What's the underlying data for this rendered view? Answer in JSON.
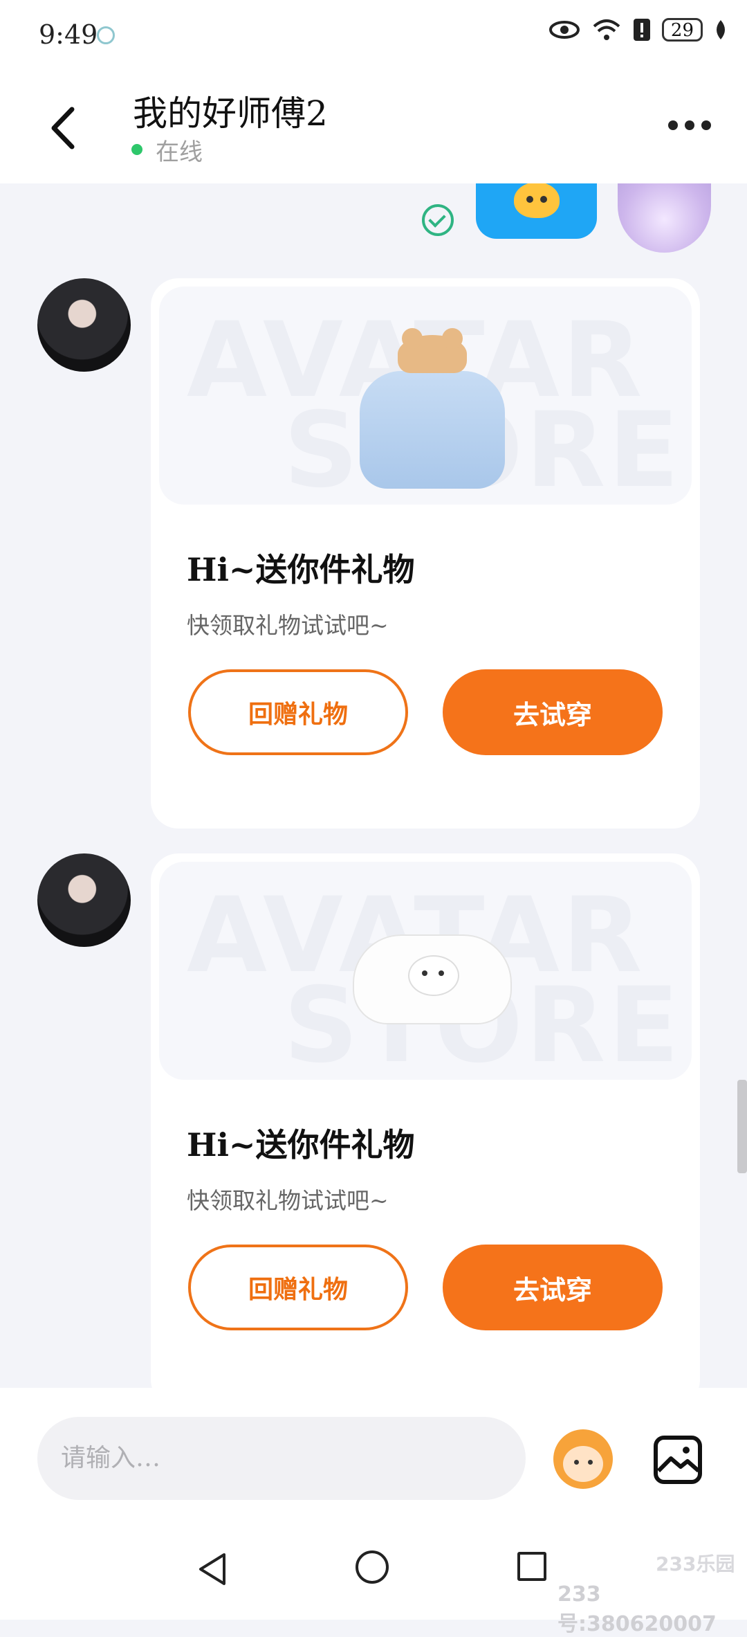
{
  "status_bar": {
    "time": "9:49",
    "battery": "29"
  },
  "header": {
    "title": "我的好师傅2",
    "status": "在线"
  },
  "gift_cards": [
    {
      "title": "Hi~送你件礼物",
      "subtitle": "快领取礼物试试吧~",
      "return_label": "回赠礼物",
      "try_label": "去试穿",
      "watermark_top": "AVATAR",
      "watermark_bottom": "STORE",
      "item": "dress-with-bear-hat"
    },
    {
      "title": "Hi~送你件礼物",
      "subtitle": "快领取礼物试试吧~",
      "return_label": "回赠礼物",
      "try_label": "去试穿",
      "watermark_top": "AVATAR",
      "watermark_bottom": "STORE",
      "item": "white-hoodie"
    }
  ],
  "input": {
    "placeholder": "请输入…"
  },
  "watermark": {
    "brand": "233乐园",
    "id": "233号:380620007"
  },
  "colors": {
    "accent": "#f5731a",
    "online": "#2ec76b",
    "read": "#2fb483",
    "background": "#f3f4f9"
  },
  "icons": [
    "back-icon",
    "more-icon",
    "read-check-icon",
    "emoji-icon",
    "image-icon",
    "nav-back-icon",
    "nav-home-icon",
    "nav-recent-icon"
  ]
}
